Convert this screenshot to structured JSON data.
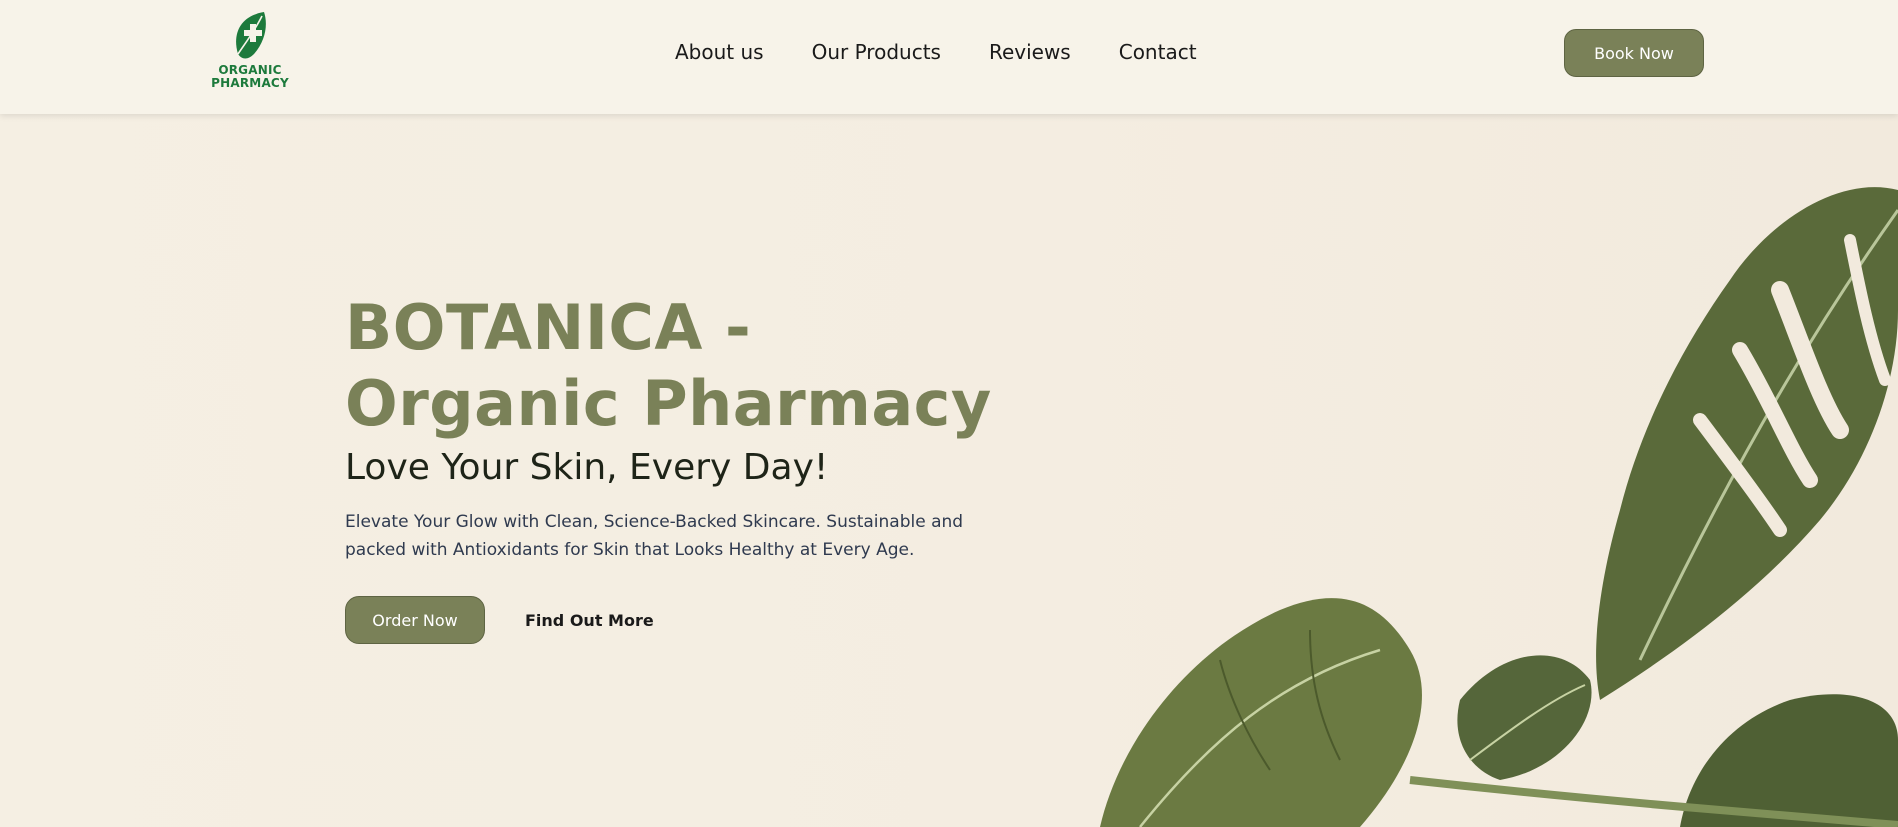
{
  "brand": {
    "logo_line1": "ORGANIC",
    "logo_line2": "PHARMACY",
    "logo_icon": "leaf-cross-icon",
    "brand_color": "#1d7a3c"
  },
  "nav": {
    "items": [
      {
        "label": "About us"
      },
      {
        "label": "Our Products"
      },
      {
        "label": "Reviews"
      },
      {
        "label": "Contact"
      }
    ]
  },
  "header": {
    "cta_label": "Book Now"
  },
  "hero": {
    "title": "BOTANICA - Organic Pharmacy",
    "subtitle": "Love Your Skin, Every Day!",
    "description": "Elevate Your Glow with Clean, Science-Backed Skincare. Sustainable and packed with Antioxidants for Skin that Looks Healthy at Every Age.",
    "primary_cta": "Order Now",
    "secondary_cta": "Find Out More",
    "image": "monstera-leaf-image"
  },
  "colors": {
    "accent": "#7a8158",
    "background": "#f6f1e6",
    "text_dark": "#1e2418"
  }
}
